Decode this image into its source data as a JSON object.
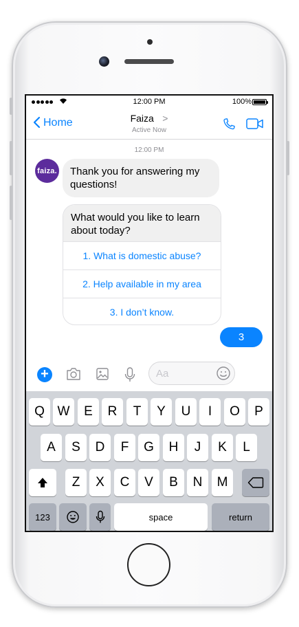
{
  "status_bar": {
    "time": "12:00 PM",
    "battery": "100%"
  },
  "nav": {
    "back_label": "Home",
    "contact_name": "Faiza",
    "contact_chevron": ">",
    "subtitle": "Active Now"
  },
  "chat": {
    "timestamp": "12:00 PM",
    "avatar_text": "faiza.",
    "messages": [
      {
        "from": "bot",
        "text": "Thank you for answering my questions!"
      }
    ],
    "card": {
      "prompt": "What would you like to learn about today?",
      "options": [
        {
          "label": "1. What is domestic abuse?"
        },
        {
          "label": "2. Help available in my area"
        },
        {
          "label": "3. I don’t know."
        }
      ]
    },
    "reply": "3"
  },
  "composer": {
    "placeholder": "Aa"
  },
  "keyboard": {
    "row1": [
      "Q",
      "W",
      "E",
      "R",
      "T",
      "Y",
      "U",
      "I",
      "O",
      "P"
    ],
    "row2": [
      "A",
      "S",
      "D",
      "F",
      "G",
      "H",
      "J",
      "K",
      "L"
    ],
    "row3": [
      "Z",
      "X",
      "C",
      "V",
      "B",
      "N",
      "M"
    ],
    "numbers_key": "123",
    "space_key": "space",
    "return_key": "return"
  },
  "colors": {
    "accent": "#0a84ff",
    "avatar": "#5c2c9c",
    "bubble": "#f0f0f0",
    "keyboard": "#d1d4d9"
  },
  "icons": [
    "chevron-left-icon",
    "phone-icon",
    "video-icon",
    "plus-icon",
    "camera-icon",
    "image-icon",
    "microphone-icon",
    "emoji-icon",
    "shift-icon",
    "backspace-icon",
    "globe-emoji-icon",
    "dictation-icon"
  ]
}
